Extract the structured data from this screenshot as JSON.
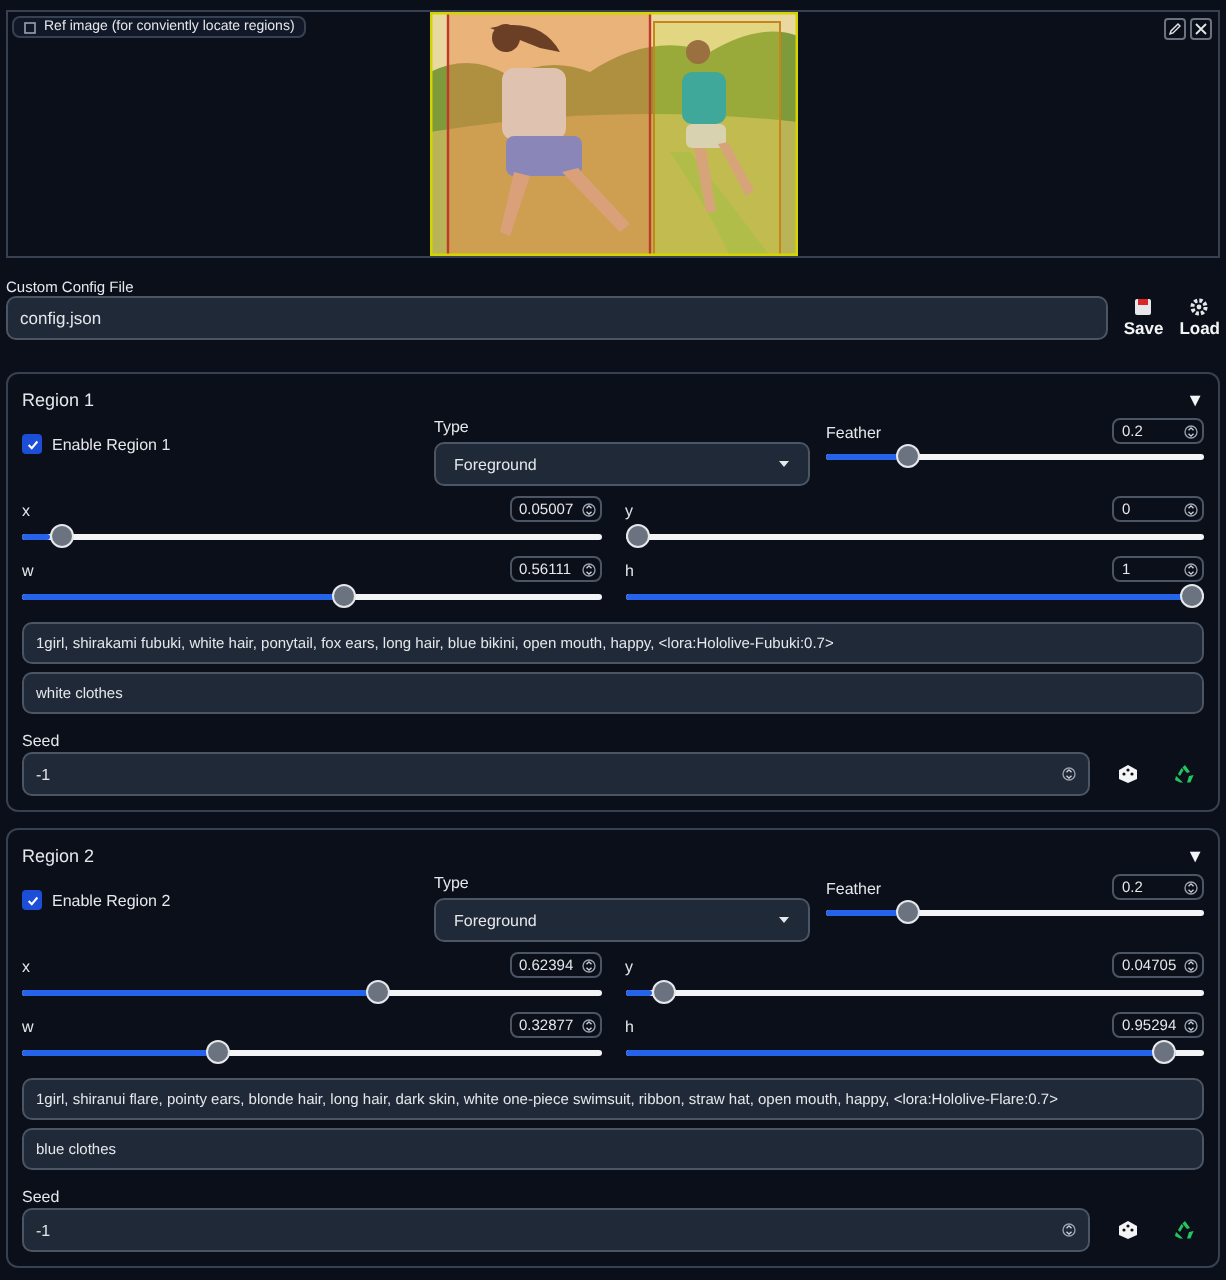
{
  "ref_image": {
    "label": "Ref image (for conviently locate regions)"
  },
  "config": {
    "label": "Custom Config File",
    "value": "config.json",
    "buttons": [
      "Save",
      "Load"
    ]
  },
  "regions": [
    {
      "title": "Region 1",
      "toggle": "▼",
      "expanded": true,
      "enable": {
        "label": "Enable Region 1",
        "checked": true
      },
      "type": {
        "label": "Type",
        "value": "Foreground"
      },
      "sliders": [
        {
          "label": "Feather",
          "value": "0.2",
          "level": 0.2
        },
        {
          "label": "x",
          "value": "0.05007",
          "level": 0.05
        },
        {
          "label": "y",
          "value": "0",
          "level": 0
        },
        {
          "label": "w",
          "value": "0.56111",
          "level": 0.56
        },
        {
          "label": "h",
          "value": "1",
          "level": 1
        }
      ],
      "prompt": "1girl, shirakami fubuki, white hair, ponytail, fox ears, long hair, blue bikini, open mouth, happy, <lora:Hololive-Fubuki:0.7>",
      "negative_prompt": "white clothes",
      "seed": {
        "label": "Seed",
        "value": "-1"
      }
    },
    {
      "title": "Region 2",
      "toggle": "▼",
      "expanded": true,
      "enable": {
        "label": "Enable Region 2",
        "checked": true
      },
      "type": {
        "label": "Type",
        "value": "Foreground"
      },
      "sliders": [
        {
          "label": "Feather",
          "value": "0.2",
          "level": 0.2
        },
        {
          "label": "x",
          "value": "0.62394",
          "level": 0.62
        },
        {
          "label": "y",
          "value": "0.04705",
          "level": 0.047
        },
        {
          "label": "w",
          "value": "0.32877",
          "level": 0.33
        },
        {
          "label": "h",
          "value": "0.95294",
          "level": 0.95
        }
      ],
      "prompt": "1girl, shiranui flare, pointy ears, blonde hair, long hair, dark skin, white one-piece swimsuit, ribbon, straw hat, open mouth, happy, <lora:Hololive-Flare:0.7>",
      "negative_prompt": "blue clothes",
      "seed": {
        "label": "Seed",
        "value": "-1"
      }
    }
  ]
}
